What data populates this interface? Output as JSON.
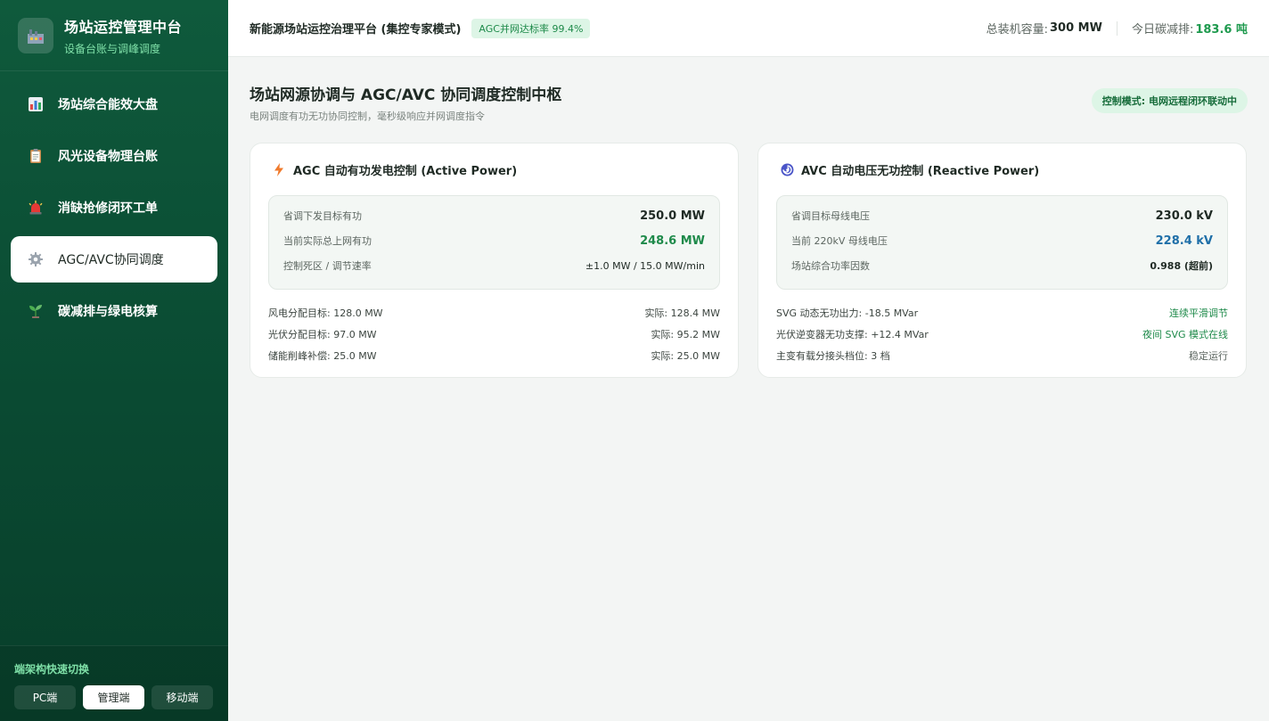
{
  "brand": {
    "title": "场站运控管理中台",
    "subtitle": "设备台账与调峰调度",
    "logo_icon": "factory-icon"
  },
  "sidebar": {
    "items": [
      {
        "label": "场站综合能效大盘",
        "icon": "bar-chart-icon",
        "active": false
      },
      {
        "label": "风光设备物理台账",
        "icon": "clipboard-icon",
        "active": false
      },
      {
        "label": "消缺抢修闭环工单",
        "icon": "siren-icon",
        "active": false
      },
      {
        "label": "AGC/AVC协同调度",
        "icon": "gear-icon",
        "active": true
      },
      {
        "label": "碳减排与绿电核算",
        "icon": "seedling-icon",
        "active": false
      }
    ],
    "switch": {
      "title": "端架构快速切换",
      "buttons": [
        {
          "label": "PC端",
          "active": false
        },
        {
          "label": "管理端",
          "active": true
        },
        {
          "label": "移动端",
          "active": false
        }
      ]
    }
  },
  "header": {
    "title": "新能源场站运控治理平台 (集控专家模式)",
    "badge": "AGC并网达标率 99.4%",
    "capacity_label": "总装机容量:",
    "capacity_value": "300 MW",
    "carbon_label": "今日碳减排:",
    "carbon_value": "183.6 吨"
  },
  "page": {
    "title": "场站网源协调与 AGC/AVC 协同调度控制中枢",
    "subtitle": "电网调度有功无功协同控制，毫秒级响应并网调度指令",
    "mode": "控制模式: 电网远程闭环联动中"
  },
  "agc": {
    "title": "AGC 自动有功发电控制 (Active Power)",
    "icon": "lightning-icon",
    "metrics": [
      {
        "label": "省调下发目标有功",
        "value": "250.0 MW"
      },
      {
        "label": "当前实际总上网有功",
        "value": "248.6 MW"
      },
      {
        "label": "控制死区 / 调节速率",
        "value": "±1.0 MW / 15.0 MW/min"
      }
    ],
    "rows": [
      {
        "left": "风电分配目标: 128.0 MW",
        "right": "实际: 128.4 MW"
      },
      {
        "left": "光伏分配目标: 97.0 MW",
        "right": "实际: 95.2 MW"
      },
      {
        "left": "储能削峰补偿: 25.0 MW",
        "right": "实际: 25.0 MW"
      }
    ]
  },
  "avc": {
    "title": "AVC 自动电压无功控制 (Reactive Power)",
    "icon": "cyclone-icon",
    "metrics": [
      {
        "label": "省调目标母线电压",
        "value": "230.0 kV"
      },
      {
        "label": "当前 220kV 母线电压",
        "value": "228.4 kV"
      },
      {
        "label": "场站综合功率因数",
        "value": "0.988 (超前)"
      }
    ],
    "rows": [
      {
        "left": "SVG 动态无功出力: -18.5 MVar",
        "right": "连续平滑调节"
      },
      {
        "left": "光伏逆变器无功支撑: +12.4 MVar",
        "right": "夜间 SVG 模式在线"
      },
      {
        "left": "主变有载分接头档位: 3 档",
        "right": "稳定运行"
      }
    ]
  },
  "colors": {
    "sidebar": "#0f5a3c",
    "accent_green": "#1e8a4a",
    "accent_blue": "#1f6fa8"
  }
}
